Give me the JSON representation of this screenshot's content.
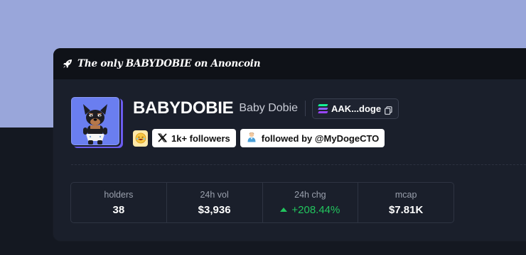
{
  "banner": {
    "icon": "rocket-icon",
    "text": "The only BABYDOBIE on Anoncoin"
  },
  "token": {
    "ticker": "BABYDOBIE",
    "name": "Baby Dobie",
    "contract_short": "AAK...doge",
    "avatar_bg": "#6a7ef0",
    "avatar_accent": "#6b5cf0"
  },
  "badges": {
    "twitter_followers": "1k+ followers",
    "followed_by": "followed by @MyDogeCTO"
  },
  "stats": [
    {
      "label": "holders",
      "value": "38"
    },
    {
      "label": "24h vol",
      "value": "$3,936"
    },
    {
      "label": "24h chg",
      "value": "+208.44%",
      "trend": "up",
      "color": "#22c55e"
    },
    {
      "label": "mcap",
      "value": "$7.81K"
    }
  ],
  "colors": {
    "page_top": "#99a6da",
    "page_bottom": "#141821",
    "card": "#1a1f2b",
    "banner": "#0f1218"
  }
}
